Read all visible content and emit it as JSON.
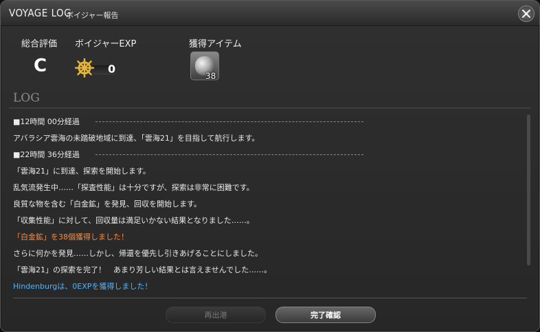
{
  "window": {
    "title": "VOYAGE LOG",
    "subtitle": "ボイジャー報告",
    "close_icon": "close-x-icon"
  },
  "summary": {
    "rating_label": "総合評価",
    "rating_value": "C",
    "exp_label": "ボイジャーEXP",
    "exp_icon": "ship-wheel-icon",
    "exp_value": "0",
    "items_label": "獲得アイテム",
    "item_icon": "platinum-ore-icon",
    "item_count": "38"
  },
  "log": {
    "heading": "LOG",
    "lines": [
      {
        "text": "■12時間 00分経過",
        "style": "marker"
      },
      {
        "text": "アバラシア雲海の未踏破地域に到達、「雲海21」を目指して航行します。",
        "style": "normal"
      },
      {
        "text": "■22時間 36分経過",
        "style": "marker"
      },
      {
        "text": "「雲海21」に到達、探索を開始します。",
        "style": "normal"
      },
      {
        "text": "乱気流発生中……「探査性能」は十分ですが、探索は非常に困難です。",
        "style": "normal"
      },
      {
        "text": "良質な物を含む「白金鉱」を発見、回収を開始します。",
        "style": "normal"
      },
      {
        "text": "「収集性能」に対して、回収量は満足いかない結果となりました……。",
        "style": "normal"
      },
      {
        "text": "「白金鉱」を38個獲得しました！",
        "style": "orange"
      },
      {
        "text": "さらに何かを発見……しかし、帰還を優先し引きあげることにしました。",
        "style": "normal"
      },
      {
        "text": "「雲海21」の探索を完了！　あまり芳しい結果とは言えませんでした……。",
        "style": "normal"
      },
      {
        "text": "Hindenburgは、0EXPを獲得しました！",
        "style": "blue"
      }
    ]
  },
  "buttons": {
    "redeploy_label": "再出港",
    "confirm_label": "完了確認"
  },
  "colors": {
    "highlight_orange": "#ff8a3c",
    "highlight_blue": "#4fb6ff"
  }
}
